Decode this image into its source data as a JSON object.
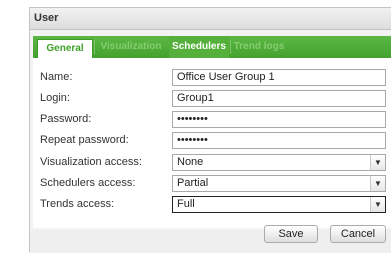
{
  "dialog": {
    "title": "User"
  },
  "tabs": [
    {
      "label": "General",
      "active": true
    },
    {
      "label": "Visualization",
      "active": false
    },
    {
      "label": "Schedulers",
      "active": false
    },
    {
      "label": "Trend logs",
      "active": false
    }
  ],
  "form": {
    "name": {
      "label": "Name:",
      "value": "Office User Group 1"
    },
    "login": {
      "label": "Login:",
      "value": "Group1"
    },
    "password": {
      "label": "Password:",
      "value": "••••••••"
    },
    "repeat_password": {
      "label": "Repeat password:",
      "value": "••••••••"
    },
    "visualization_access": {
      "label": "Visualization access:",
      "value": "None"
    },
    "schedulers_access": {
      "label": "Schedulers access:",
      "value": "Partial"
    },
    "trends_access": {
      "label": "Trends access:",
      "value": "Full"
    }
  },
  "buttons": {
    "save": "Save",
    "cancel": "Cancel"
  },
  "icons": {
    "dropdown": "chevron-down-icon"
  },
  "colors": {
    "tab_bar": "#4caa35",
    "active_tab_text": "#3fa229"
  }
}
